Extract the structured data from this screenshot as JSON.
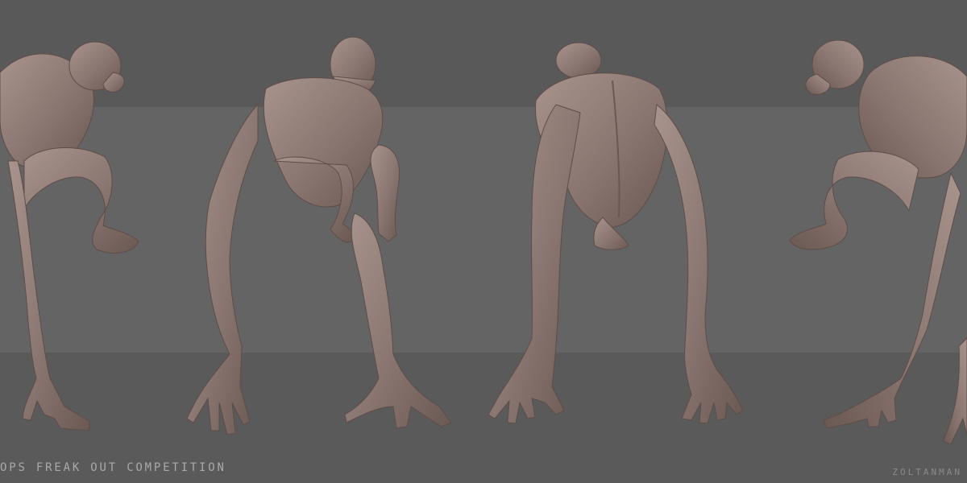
{
  "caption": "OPS FREAK OUT COMPETITION",
  "signature": "ZOLTANMAN",
  "colors": {
    "background_top": "#595959",
    "background_mid": "#646464",
    "background_bottom": "#5a5a5a",
    "sculpt_clay": "#8a7670",
    "sculpt_shadow": "#6a5852",
    "sculpt_highlight": "#a8948d"
  },
  "views": [
    {
      "name": "side-view-right-facing"
    },
    {
      "name": "front-view"
    },
    {
      "name": "back-view"
    },
    {
      "name": "side-view-left-facing"
    }
  ]
}
